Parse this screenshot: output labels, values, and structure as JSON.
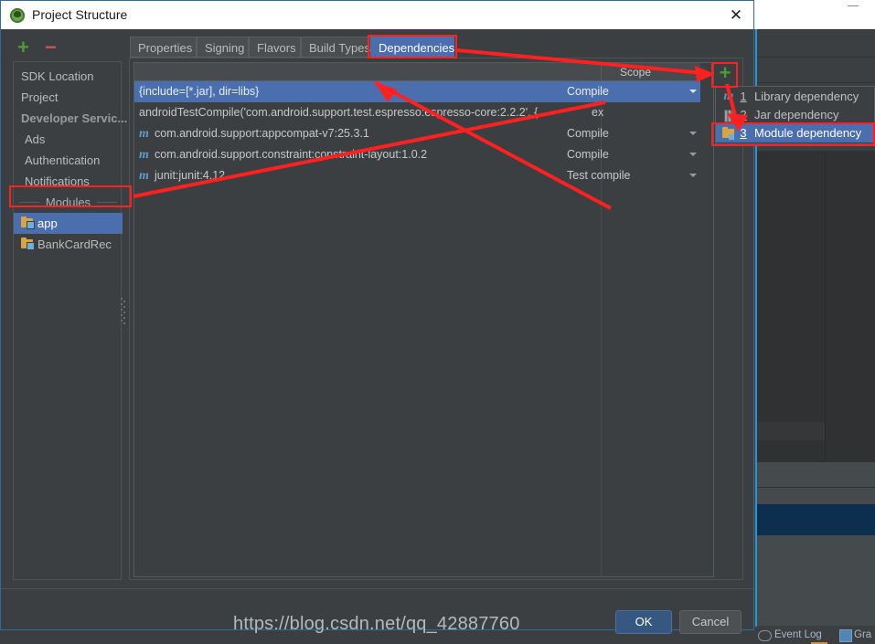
{
  "window": {
    "title": "Project Structure",
    "app_icon": "android-studio-icon",
    "close_label": "✕",
    "minimize_label": "—"
  },
  "sidebar": {
    "add_label": "+",
    "remove_label": "−",
    "items": [
      {
        "label": "SDK Location",
        "type": "item"
      },
      {
        "label": "Project",
        "type": "item"
      },
      {
        "label": "Developer Servic...",
        "type": "group"
      },
      {
        "label": "Ads",
        "type": "item"
      },
      {
        "label": "Authentication",
        "type": "item"
      },
      {
        "label": "Notifications",
        "type": "item"
      },
      {
        "label": "Modules",
        "type": "separator"
      },
      {
        "label": "app",
        "type": "module",
        "selected": true
      },
      {
        "label": "BankCardRec",
        "type": "module",
        "selected": false
      }
    ]
  },
  "tabs": [
    {
      "label": "Properties",
      "active": false
    },
    {
      "label": "Signing",
      "active": false
    },
    {
      "label": "Flavors",
      "active": false
    },
    {
      "label": "Build Types",
      "active": false
    },
    {
      "label": "Dependencies",
      "active": true
    }
  ],
  "table": {
    "columns": [
      "",
      "Scope"
    ],
    "scope_header": "Scope",
    "rows": [
      {
        "name": "{include=[*.jar], dir=libs}",
        "scope": "Compile",
        "selected": true,
        "icon": "none",
        "extra": ""
      },
      {
        "name": "androidTestCompile('com.android.support.test.espresso:espresso-core:2.2.2', {",
        "scope": "",
        "selected": false,
        "icon": "none",
        "extra": "ex"
      },
      {
        "name": "com.android.support:appcompat-v7:25.3.1",
        "scope": "Compile",
        "selected": false,
        "icon": "maven-m-icon",
        "extra": ""
      },
      {
        "name": "com.android.support.constraint:constraint-layout:1.0.2",
        "scope": "Compile",
        "selected": false,
        "icon": "maven-m-icon",
        "extra": ""
      },
      {
        "name": "junit:junit:4.12",
        "scope": "Test compile",
        "selected": false,
        "icon": "maven-m-icon",
        "extra": ""
      }
    ]
  },
  "add_menu": {
    "button_label": "+",
    "items": [
      {
        "num": "1",
        "label": "Library dependency",
        "icon": "maven-m-icon",
        "selected": false
      },
      {
        "num": "2",
        "label": "Jar dependency",
        "icon": "jar-icon",
        "selected": false
      },
      {
        "num": "3",
        "label": "Module dependency",
        "icon": "module-folder-icon",
        "selected": true
      }
    ]
  },
  "footer": {
    "ok_label": "OK",
    "cancel_label": "Cancel"
  },
  "statusbar": {
    "event_log": "Event Log",
    "gradle": "Gra"
  },
  "watermark": {
    "text": "https://blog.csdn.net/qq_42887760"
  },
  "colors": {
    "accent_selection": "#4b6eaf",
    "annotation_red": "#ff2020",
    "add_green": "#4e9a3a",
    "remove_red": "#c75450",
    "panel_bg": "#3c3f41",
    "maven_blue": "#5c9ccc"
  }
}
